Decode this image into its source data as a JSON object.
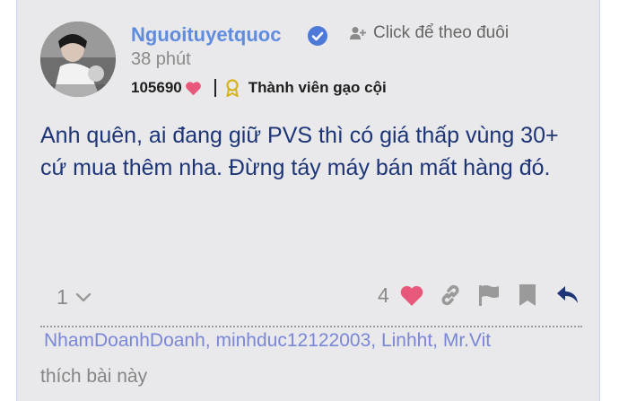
{
  "post": {
    "username": "Nguoituyetquoc",
    "follow_label": "Click để theo đuôi",
    "time": "38 phút",
    "points": "105690",
    "rank": "Thành viên gạo cội",
    "body": "Anh quên, ai đang giữ PVS thì có giá thấp vùng 30+ cứ mua thêm nha. Đừng táy máy bán mất hàng đó.",
    "reply_count": "1",
    "like_count": "4",
    "likers": [
      "NhamDoanhDoanh",
      "minhduc12122003",
      "Linhht",
      "Mr.Vit"
    ],
    "likers_suffix": "thích bài này"
  },
  "icons": {
    "verified": "verified-check-icon",
    "follow": "add-user-icon",
    "heart": "heart-icon",
    "award": "award-badge-icon",
    "chevron": "chevron-down-icon",
    "link": "link-icon",
    "flag": "flag-icon",
    "bookmark": "bookmark-icon",
    "reply": "reply-icon"
  },
  "colors": {
    "username": "#5f8cde",
    "body_text": "#1d3577",
    "heart": "#e7587a",
    "likers": "#7a86d6",
    "reply": "#1d3577"
  }
}
